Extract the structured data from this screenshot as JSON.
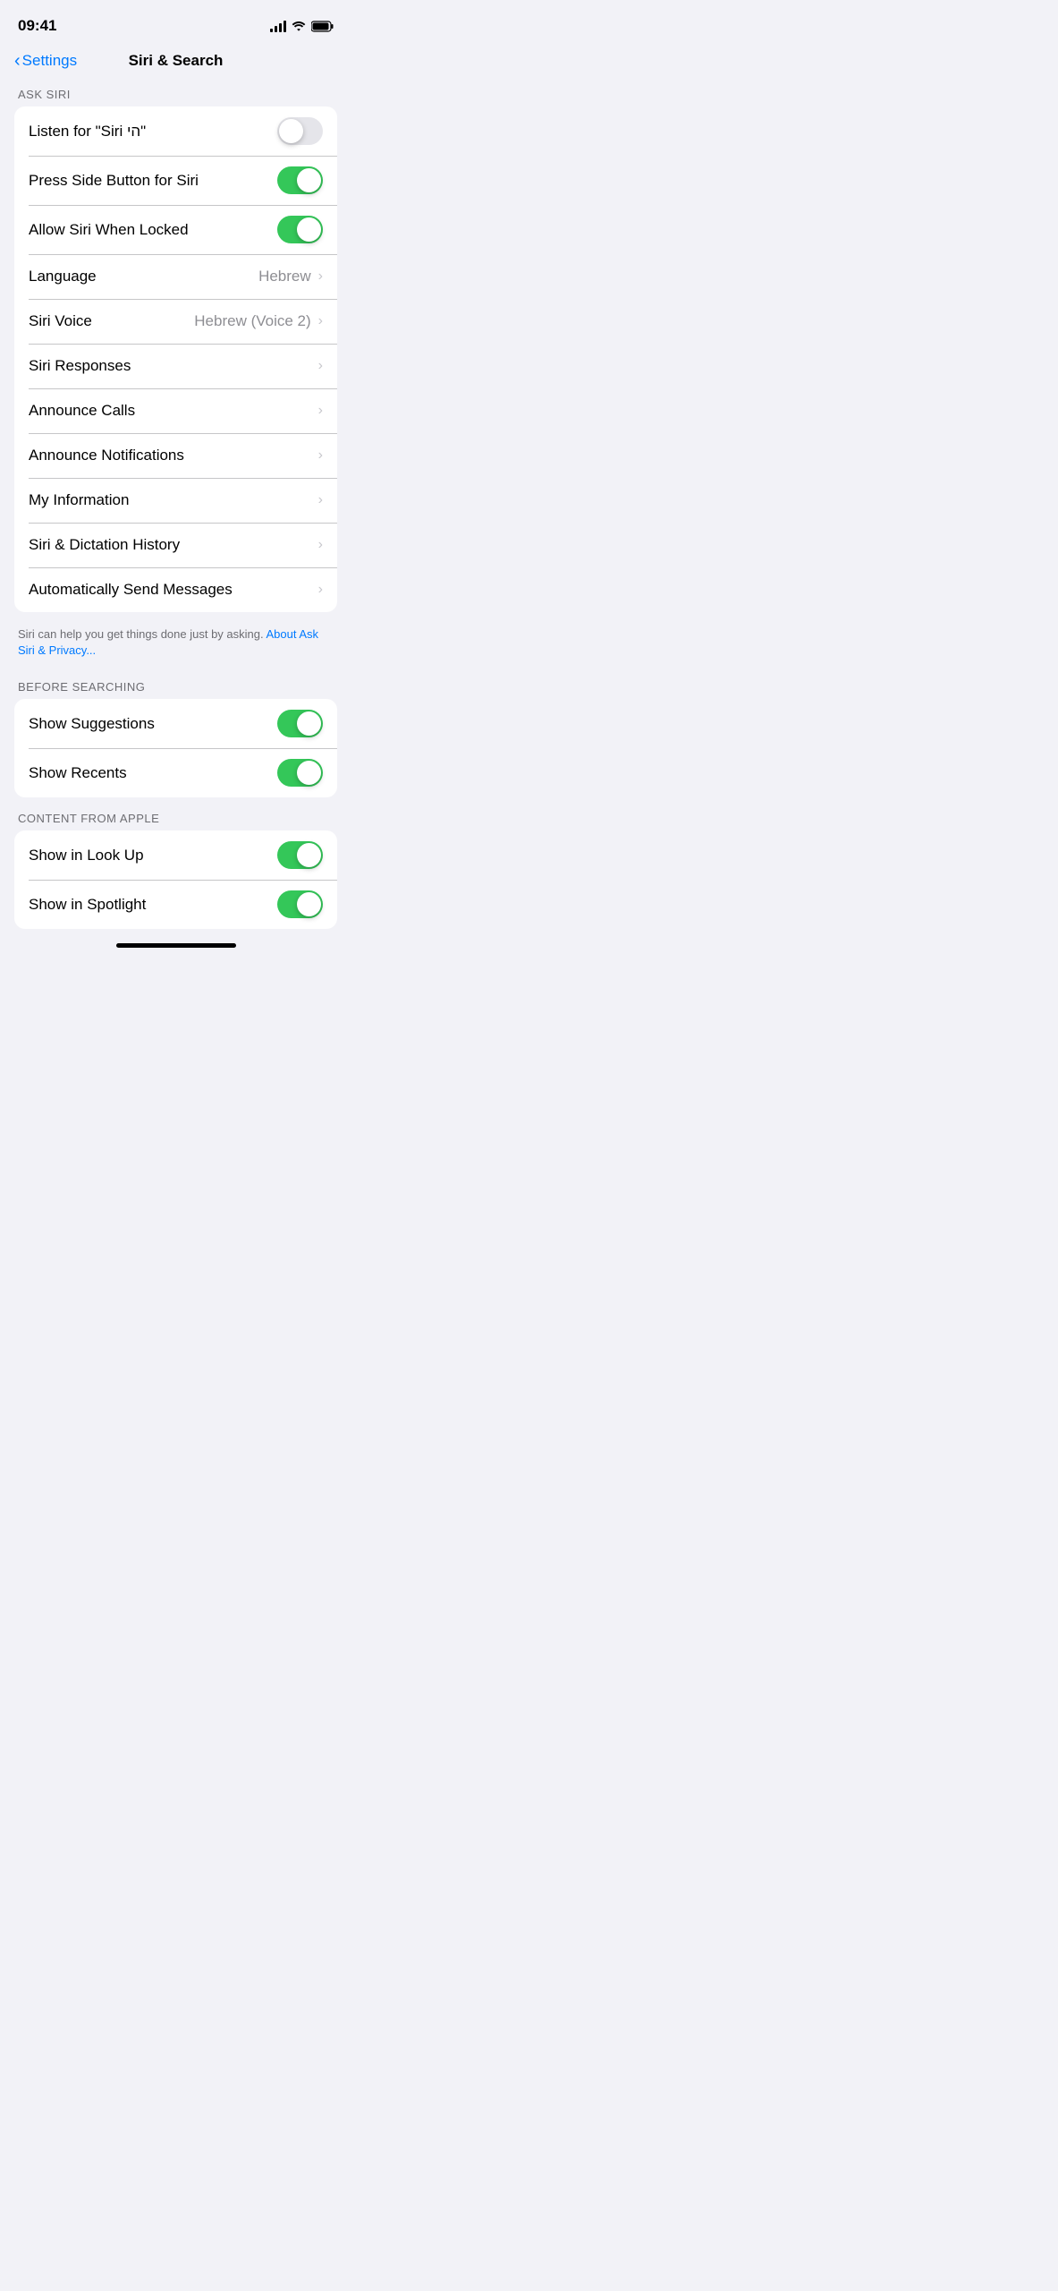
{
  "statusBar": {
    "time": "09:41"
  },
  "navBar": {
    "backLabel": "Settings",
    "title": "Siri & Search"
  },
  "sections": [
    {
      "id": "ask-siri",
      "header": "ASK SIRI",
      "rows": [
        {
          "id": "listen-siri",
          "label": "Listen for \"Siri הי\"",
          "type": "toggle",
          "toggleState": "off"
        },
        {
          "id": "press-side",
          "label": "Press Side Button for Siri",
          "type": "toggle",
          "toggleState": "on"
        },
        {
          "id": "allow-locked",
          "label": "Allow Siri When Locked",
          "type": "toggle",
          "toggleState": "on"
        },
        {
          "id": "language",
          "label": "Language",
          "type": "value-chevron",
          "value": "Hebrew"
        },
        {
          "id": "siri-voice",
          "label": "Siri Voice",
          "type": "value-chevron",
          "value": "Hebrew (Voice 2)"
        },
        {
          "id": "siri-responses",
          "label": "Siri Responses",
          "type": "chevron"
        },
        {
          "id": "announce-calls",
          "label": "Announce Calls",
          "type": "chevron"
        },
        {
          "id": "announce-notifications",
          "label": "Announce Notifications",
          "type": "chevron"
        },
        {
          "id": "my-information",
          "label": "My Information",
          "type": "chevron"
        },
        {
          "id": "siri-dictation-history",
          "label": "Siri & Dictation History",
          "type": "chevron"
        },
        {
          "id": "auto-send-messages",
          "label": "Automatically Send Messages",
          "type": "chevron"
        }
      ],
      "footer": "Siri can help you get things done just by asking. ",
      "footerLink": "About Ask Siri & Privacy...",
      "footerLinkHref": "#"
    },
    {
      "id": "before-searching",
      "header": "BEFORE SEARCHING",
      "rows": [
        {
          "id": "show-suggestions",
          "label": "Show Suggestions",
          "type": "toggle",
          "toggleState": "on"
        },
        {
          "id": "show-recents",
          "label": "Show Recents",
          "type": "toggle",
          "toggleState": "on"
        }
      ]
    },
    {
      "id": "content-from-apple",
      "header": "CONTENT FROM APPLE",
      "rows": [
        {
          "id": "show-in-look-up",
          "label": "Show in Look Up",
          "type": "toggle",
          "toggleState": "on"
        },
        {
          "id": "show-in-spotlight",
          "label": "Show in Spotlight",
          "type": "toggle",
          "toggleState": "on"
        }
      ]
    }
  ]
}
